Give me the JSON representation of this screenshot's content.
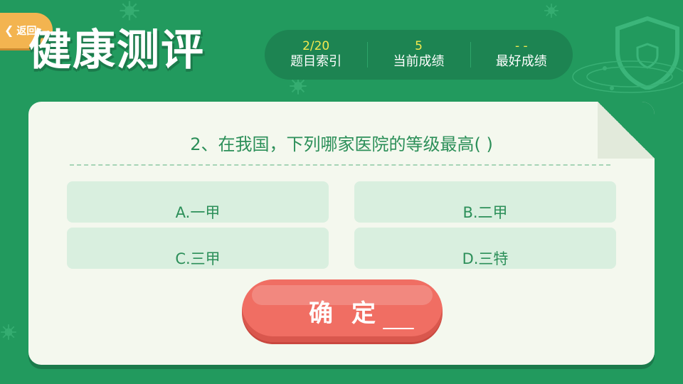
{
  "header": {
    "back_label": "返回",
    "title": "健康测评"
  },
  "stats": [
    {
      "value": "2/20",
      "label": "题目索引"
    },
    {
      "value": "5",
      "label": "当前成绩"
    },
    {
      "value": "- -",
      "label": "最好成绩"
    }
  ],
  "quiz": {
    "question": "2、在我国，下列哪家医院的等级最高(   )",
    "options": [
      {
        "label": "A.一甲"
      },
      {
        "label": "B.二甲"
      },
      {
        "label": "C.三甲"
      },
      {
        "label": "D.三特"
      }
    ],
    "confirm_label": "确定"
  },
  "colors": {
    "background": "#229a5e",
    "stat_value": "#f3e94f",
    "confirm_button": "#f06e63",
    "option_bg": "#d9efdf"
  },
  "icons": [
    "chevron-left-icon",
    "shield-icon",
    "virus-icon"
  ]
}
